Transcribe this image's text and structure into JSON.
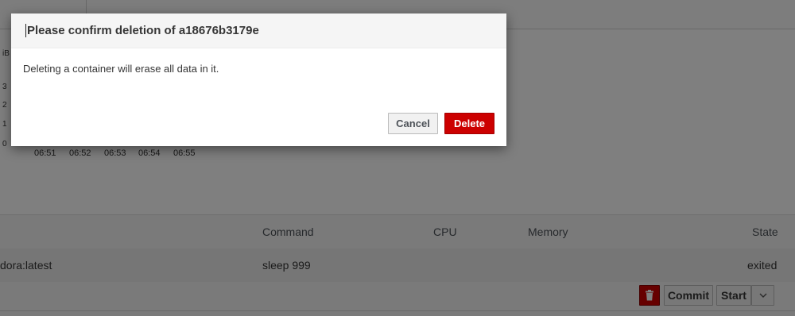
{
  "chart": {
    "y_unit_fragment": "iB",
    "y_ticks": [
      "3",
      "2",
      "1",
      "0"
    ],
    "x_ticks": [
      "06:51",
      "06:52",
      "06:53",
      "06:54",
      "06:55"
    ]
  },
  "table": {
    "headers": {
      "command": "Command",
      "cpu": "CPU",
      "memory": "Memory",
      "state": "State"
    },
    "row": {
      "image": "dora:latest",
      "command": "sleep 999",
      "state": "exited"
    }
  },
  "actions": {
    "commit_label": "Commit",
    "start_label": "Start",
    "trash_icon": "trash-icon",
    "dropdown_icon": "chevron-down-icon"
  },
  "dialog": {
    "title": "Please confirm deletion of a18676b3179e",
    "body": "Deleting a container will erase all data in it.",
    "cancel_label": "Cancel",
    "delete_label": "Delete"
  },
  "colors": {
    "danger": "#cc0000",
    "overlay": "rgba(0,0,0,0.5)"
  }
}
